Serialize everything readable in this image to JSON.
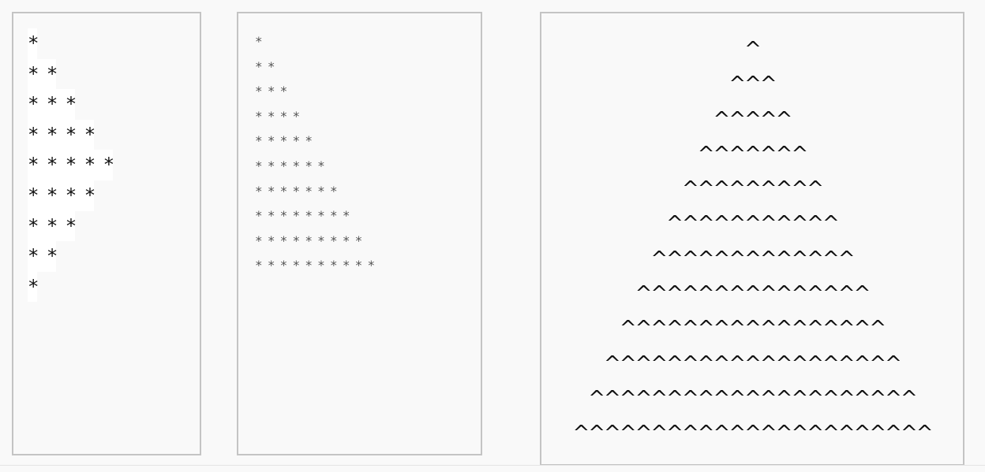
{
  "panels": [
    {
      "name": "asterisk-diamond-panel",
      "lines": [
        "*",
        "* *",
        "* * *",
        "* * * *",
        "* * * * *",
        "* * * *",
        "* * *",
        "* *",
        "*"
      ]
    },
    {
      "name": "asterisk-triangle-panel",
      "lines": [
        "*",
        "**",
        "***",
        "****",
        "*****",
        "******",
        "*******",
        "********",
        "*********",
        "**********"
      ]
    },
    {
      "name": "caret-pyramid-panel",
      "lines": [
        "^",
        "^^^",
        "^^^^^",
        "^^^^^^^",
        "^^^^^^^^^",
        "^^^^^^^^^^^",
        "^^^^^^^^^^^^^",
        "^^^^^^^^^^^^^^^",
        "^^^^^^^^^^^^^^^^^",
        "^^^^^^^^^^^^^^^^^^^",
        "^^^^^^^^^^^^^^^^^^^^^",
        "^^^^^^^^^^^^^^^^^^^^^^^"
      ]
    }
  ],
  "colors": {
    "background": "#f9f9f9",
    "panel_border": "#c4c4c4",
    "text": "#111111",
    "muted_text": "#555555"
  }
}
